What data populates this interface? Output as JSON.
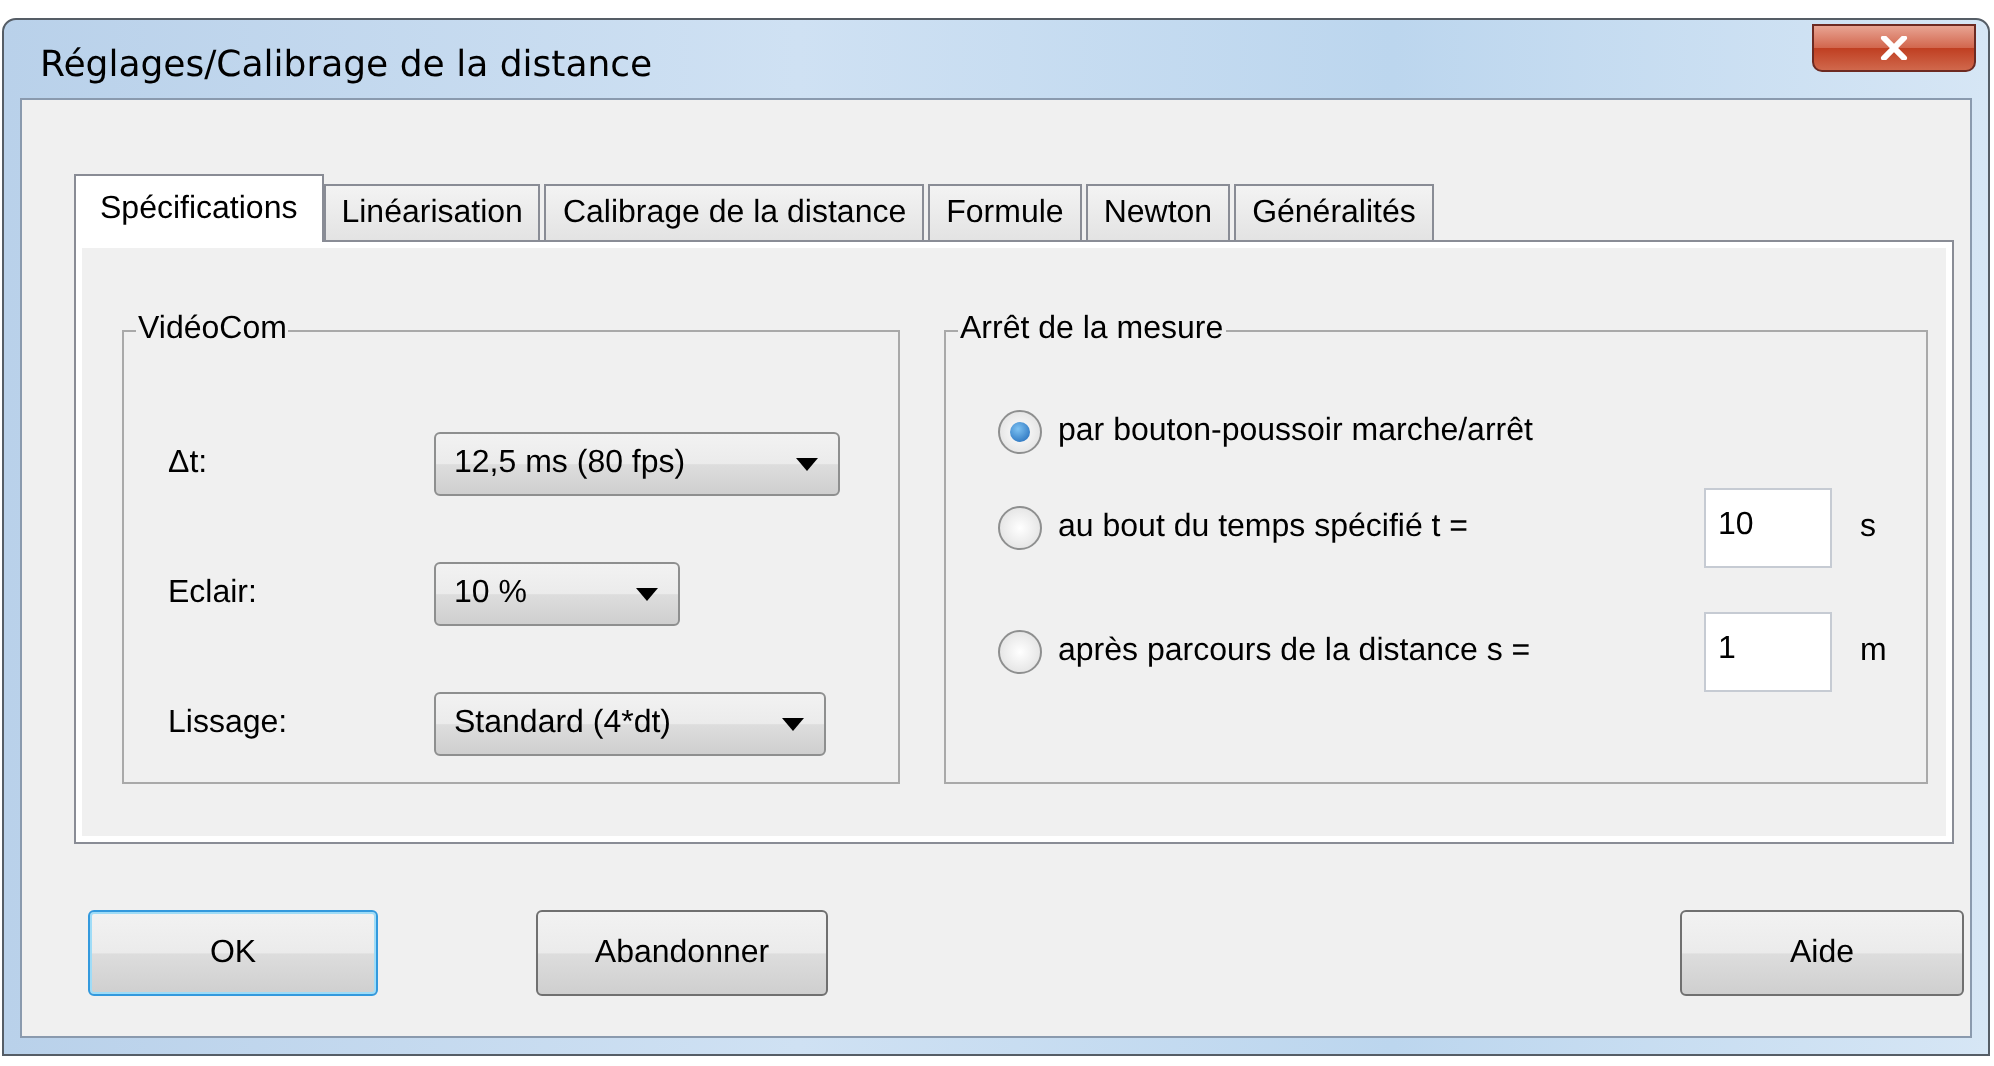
{
  "window": {
    "title": "Réglages/Calibrage de la distance"
  },
  "tabs": [
    {
      "label": "Spécifications",
      "selected": true
    },
    {
      "label": "Linéarisation",
      "selected": false
    },
    {
      "label": "Calibrage de la distance",
      "selected": false
    },
    {
      "label": "Formule",
      "selected": false
    },
    {
      "label": "Newton",
      "selected": false
    },
    {
      "label": "Généralités",
      "selected": false
    }
  ],
  "videocom_group": {
    "title": "VidéoCom",
    "fields": [
      {
        "label": "Δt:",
        "value": "12,5 ms (80 fps)"
      },
      {
        "label": "Eclair:",
        "value": "10 %"
      },
      {
        "label": "Lissage:",
        "value": "Standard (4*dt)"
      }
    ]
  },
  "stop_group": {
    "title": "Arrêt de la mesure",
    "options": [
      {
        "label": "par bouton-poussoir marche/arrêt",
        "selected": true
      },
      {
        "label": "au bout du temps spécifié t =",
        "selected": false,
        "value": "10",
        "unit": "s"
      },
      {
        "label": "après parcours de la distance s =",
        "selected": false,
        "value": "1",
        "unit": "m"
      }
    ]
  },
  "buttons": [
    {
      "label": "OK",
      "default": true
    },
    {
      "label": "Abandonner",
      "default": false
    },
    {
      "label": "Aide",
      "default": false
    }
  ]
}
